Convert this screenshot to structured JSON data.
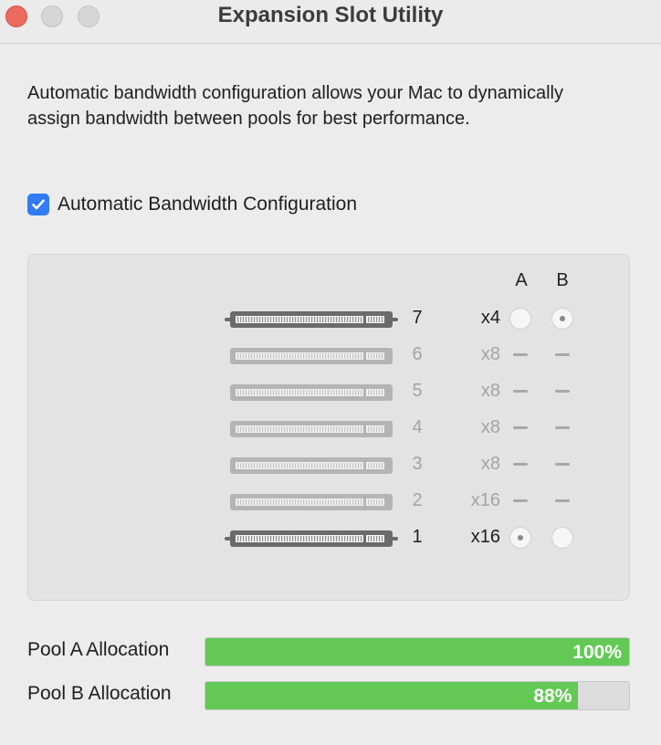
{
  "window": {
    "title": "Expansion Slot Utility"
  },
  "description": "Automatic bandwidth configuration allows your Mac to dynamically assign bandwidth between pools for best performance.",
  "auto_config": {
    "label": "Automatic Bandwidth Configuration",
    "checked": true
  },
  "slots_panel": {
    "column_a": "A",
    "column_b": "B",
    "slots": [
      {
        "number": "7",
        "width": "x4",
        "enabled": true,
        "pool": "B"
      },
      {
        "number": "6",
        "width": "x8",
        "enabled": false,
        "pool": null
      },
      {
        "number": "5",
        "width": "x8",
        "enabled": false,
        "pool": null
      },
      {
        "number": "4",
        "width": "x8",
        "enabled": false,
        "pool": null
      },
      {
        "number": "3",
        "width": "x8",
        "enabled": false,
        "pool": null
      },
      {
        "number": "2",
        "width": "x16",
        "enabled": false,
        "pool": null
      },
      {
        "number": "1",
        "width": "x16",
        "enabled": true,
        "pool": "A"
      }
    ]
  },
  "allocation": {
    "pool_a": {
      "label": "Pool A Allocation",
      "percent_text": "100%",
      "fraction": 1.0
    },
    "pool_b": {
      "label": "Pool B Allocation",
      "percent_text": "88%",
      "fraction": 0.88
    }
  },
  "colors": {
    "accent": "#2f7cf6",
    "bar_fill": "#62c955",
    "close_button": "#ed6a5e"
  }
}
